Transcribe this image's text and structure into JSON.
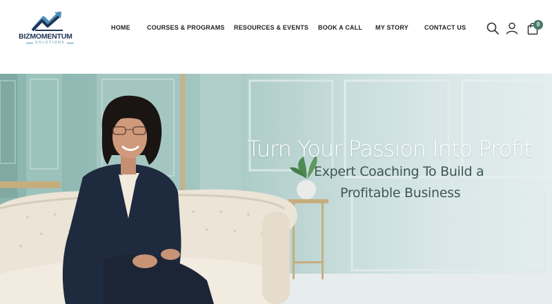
{
  "brand": {
    "name": "BIZMOMENTUM",
    "tagline": "SOLUTIONS"
  },
  "nav": {
    "items": [
      {
        "label": "HOME"
      },
      {
        "label": "COURSES & PROGRAMS"
      },
      {
        "label": "RESOURCES & EVENTS"
      },
      {
        "label": "BOOK A CALL"
      },
      {
        "label": "MY STORY"
      },
      {
        "label": "CONTACT US"
      }
    ]
  },
  "header_icons": {
    "search": "search-icon",
    "account": "user-icon",
    "cart": "shopping-bag-icon",
    "cart_count": "0"
  },
  "hero": {
    "title": "Turn Your Passion Into Profit",
    "subtitle_line1": "Expert Coaching To Build a",
    "subtitle_line2": "Profitable Business"
  },
  "colors": {
    "brand_navy": "#1f3556",
    "brand_blue": "#4c8fb8",
    "accent_green": "#4b7a6e",
    "hero_teal": "#8ab5ae"
  }
}
